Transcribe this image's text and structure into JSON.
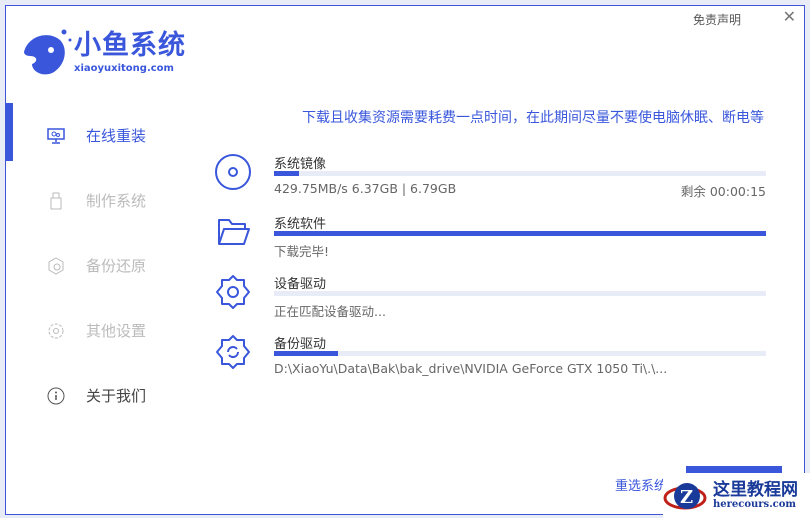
{
  "app": {
    "logo_title": "小鱼系统",
    "logo_sub": "xiaoyuxitong.com",
    "disclaimer": "免责声明",
    "close": "✕"
  },
  "sidebar": {
    "items": [
      {
        "label": "在线重装",
        "icon": "monitor-icon"
      },
      {
        "label": "制作系统",
        "icon": "usb-icon"
      },
      {
        "label": "备份还原",
        "icon": "backup-icon"
      },
      {
        "label": "其他设置",
        "icon": "gear-icon"
      },
      {
        "label": "关于我们",
        "icon": "info-icon"
      }
    ]
  },
  "main": {
    "notice": "下载且收集资源需要耗费一点时间，在此期间尽量不要使电脑休眠、断电等",
    "tasks": [
      {
        "name": "系统镜像",
        "progress": 5,
        "info": "429.75MB/s 6.37GB | 6.79GB",
        "remain": "剩余 00:00:15",
        "icon": "disc-icon"
      },
      {
        "name": "系统软件",
        "progress": 100,
        "info": "下载完毕!",
        "icon": "folder-icon"
      },
      {
        "name": "设备驱动",
        "progress": 0,
        "info": "正在匹配设备驱动...",
        "icon": "gear-icon"
      },
      {
        "name": "备份驱动",
        "progress": 13,
        "info": "D:\\XiaoYu\\Data\\Bak\\bak_drive\\NVIDIA GeForce GTX 1050 Ti\\.\\...",
        "icon": "gear-sync-icon"
      }
    ],
    "reselect": "重选系统"
  },
  "watermark": {
    "title": "这里教程网",
    "sub": "herecours.com"
  },
  "colors": {
    "accent": "#3a57dc"
  }
}
